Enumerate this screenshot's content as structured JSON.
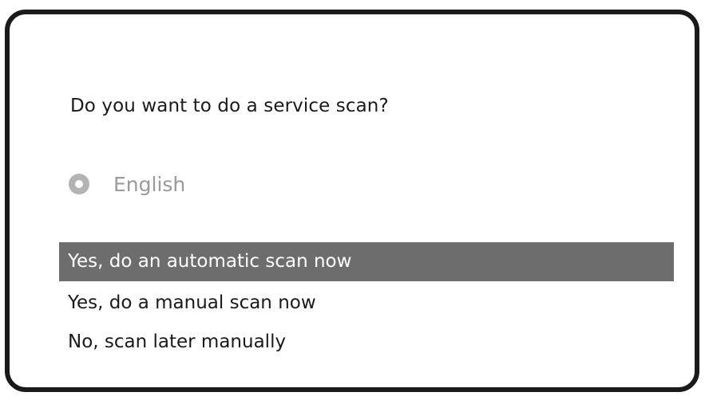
{
  "dialog": {
    "question": "Do you want to do a service scan?",
    "language": {
      "icon": "radio-icon",
      "label": "English"
    },
    "options": [
      {
        "label": "Yes, do an automatic scan now",
        "selected": true
      },
      {
        "label": "Yes, do a manual scan now",
        "selected": false
      },
      {
        "label": "No, scan later manually",
        "selected": false
      }
    ]
  },
  "colors": {
    "frame": "#1a1a1a",
    "highlight": "#6d6d6d",
    "muted": "#9a9a9a"
  }
}
